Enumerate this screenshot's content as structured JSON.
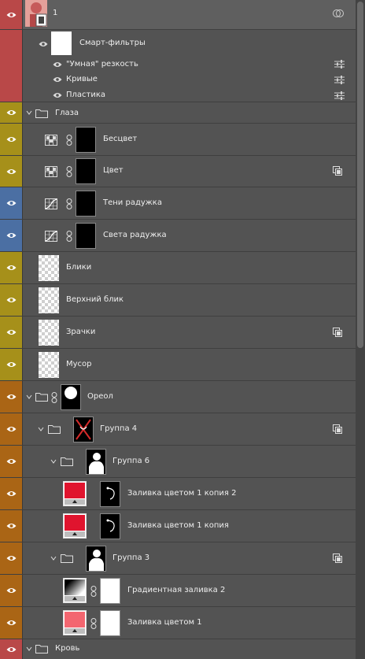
{
  "colors": {
    "red": "#b94848",
    "yellow": "#a6901a",
    "blue": "#4b6fa3",
    "orange": "#aa6515",
    "panel": "#535353"
  },
  "top_layer": {
    "name": "1"
  },
  "smart_filters": {
    "label": "Смарт-фильтры",
    "items": [
      "\"Умная\" резкость",
      "Кривые",
      "Пластика"
    ]
  },
  "layers": [
    {
      "name": "Глаза"
    },
    {
      "name": "Бесцвет"
    },
    {
      "name": "Цвет"
    },
    {
      "name": "Тени радужка"
    },
    {
      "name": "Света радужка"
    },
    {
      "name": "Блики"
    },
    {
      "name": "Верхний блик"
    },
    {
      "name": "Зрачки"
    },
    {
      "name": "Мусор"
    },
    {
      "name": "Ореол"
    },
    {
      "name": "Группа 4"
    },
    {
      "name": "Группа 6"
    },
    {
      "name": "Заливка цветом 1 копия 2"
    },
    {
      "name": "Заливка цветом 1 копия"
    },
    {
      "name": "Группа 3"
    },
    {
      "name": "Градиентная заливка 2"
    },
    {
      "name": "Заливка цветом 1"
    },
    {
      "name": "Кровь"
    }
  ]
}
